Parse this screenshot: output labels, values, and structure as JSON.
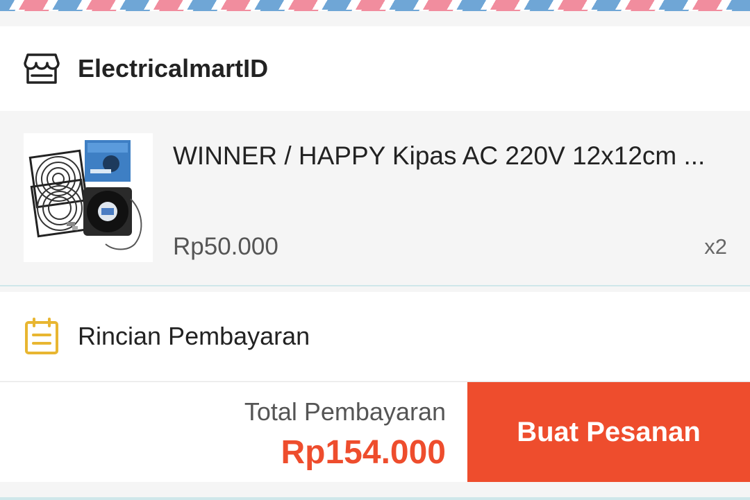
{
  "shop": {
    "name": "ElectricalmartID",
    "icon": "store-icon"
  },
  "product": {
    "title": "WINNER / HAPPY Kipas AC 220V 12x12cm ...",
    "price": "Rp50.000",
    "quantity": "x2",
    "image": "fan-product-image"
  },
  "payment": {
    "title": "Rincian Pembayaran",
    "icon": "document-list-icon"
  },
  "checkout": {
    "total_label": "Total Pembayaran",
    "total_value": "Rp154.000",
    "order_button_label": "Buat Pesanan"
  },
  "colors": {
    "accent": "#ee4d2d",
    "payment_icon": "#e8b631",
    "airmail_blue": "#6fa6d6",
    "airmail_pink": "#f18d9e"
  }
}
